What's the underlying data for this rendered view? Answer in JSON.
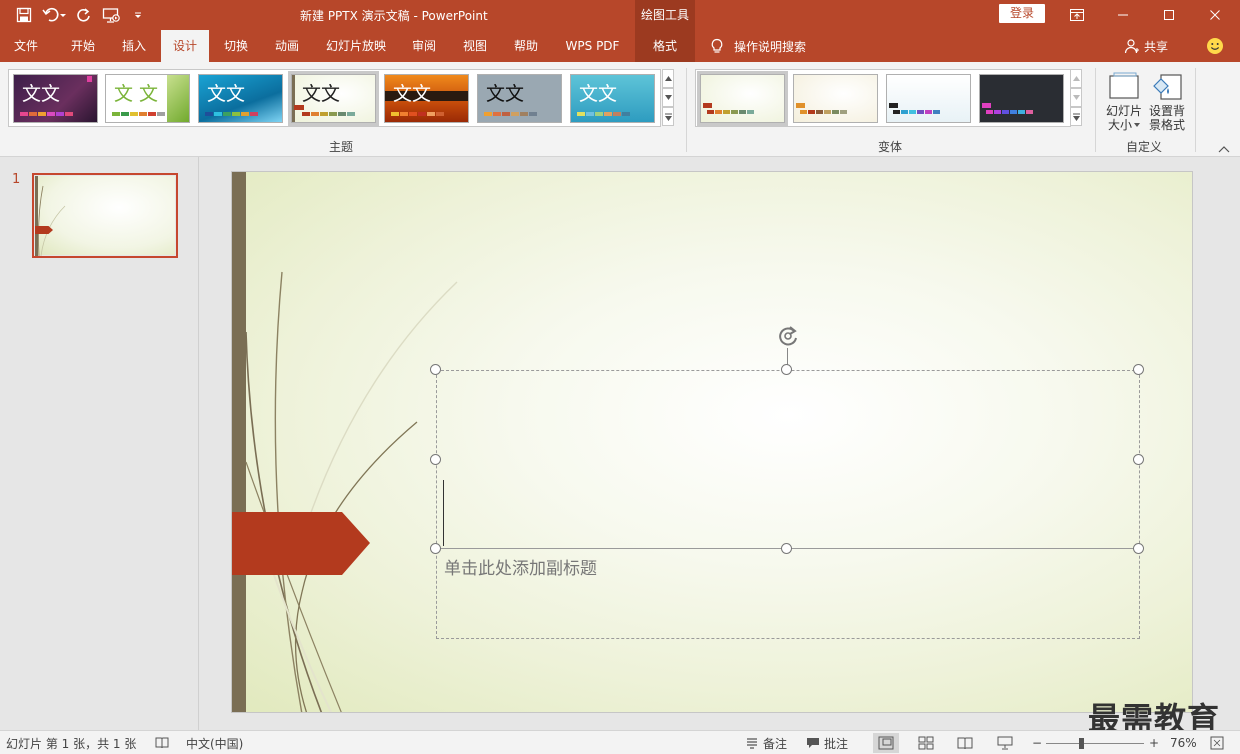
{
  "window": {
    "title": "新建 PPTX 演示文稿  -  PowerPoint",
    "context_header": "绘图工具",
    "login_label": "登录",
    "share_label": "共享",
    "tell_me": "操作说明搜索"
  },
  "tabs": [
    {
      "label": "文件"
    },
    {
      "label": "开始"
    },
    {
      "label": "插入"
    },
    {
      "label": "设计"
    },
    {
      "label": "切换"
    },
    {
      "label": "动画"
    },
    {
      "label": "幻灯片放映"
    },
    {
      "label": "审阅"
    },
    {
      "label": "视图"
    },
    {
      "label": "帮助"
    },
    {
      "label": "WPS PDF"
    },
    {
      "label": "格式"
    }
  ],
  "active_tab": "设计",
  "ribbon": {
    "themes_group": "主题",
    "variants_group": "变体",
    "customize_group": "自定义",
    "theme_sample_text": "文文",
    "theme_sample_text_spaced": "文 文",
    "slide_size_label_1": "幻灯片",
    "slide_size_label_2": "大小",
    "format_bg_label_1": "设置背",
    "format_bg_label_2": "景格式",
    "colors": {
      "accent": "#b7472a",
      "context_tab": "#9c3a20"
    }
  },
  "slides_panel": {
    "slide_number": "1"
  },
  "slide": {
    "subtitle_placeholder": "单击此处添加副标题"
  },
  "watermark": "最需教育",
  "statusbar": {
    "slide_info": "幻灯片 第 1 张，共 1 张",
    "language": "中文(中国)",
    "notes_label": "备注",
    "comments_label": "批注",
    "zoom": "76%",
    "zoom_minus": "−",
    "zoom_plus": "+"
  }
}
